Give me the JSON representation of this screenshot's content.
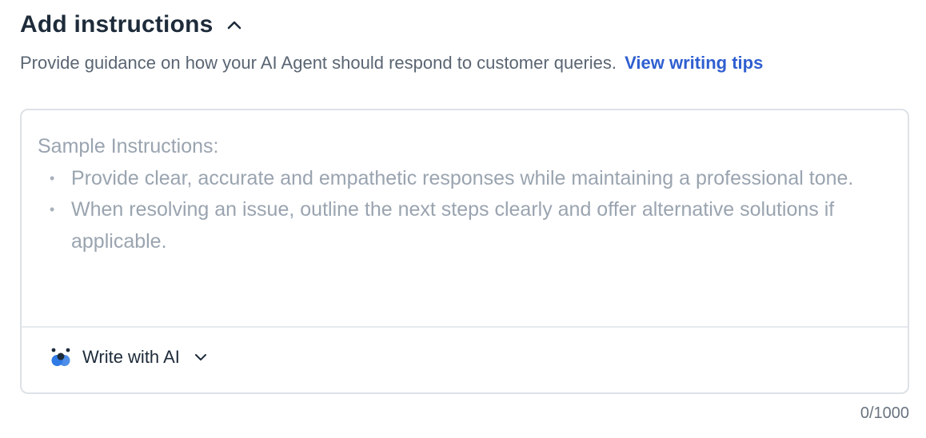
{
  "section": {
    "title": "Add instructions",
    "description": "Provide guidance on how your AI Agent should respond to customer queries.",
    "link_label": "View writing tips"
  },
  "editor": {
    "value": "",
    "placeholder_heading": "Sample Instructions:",
    "placeholder_items": [
      "Provide clear, accurate and empathetic responses while maintaining a professional tone.",
      "When resolving an issue, outline the next steps clearly and offer alternative solutions if applicable."
    ],
    "write_with_ai_label": "Write with AI",
    "char_count": "0/1000"
  },
  "icons": {
    "collapse": "chevron-up-icon",
    "ai": "ai-assistant-icon",
    "dropdown": "chevron-down-icon"
  },
  "colors": {
    "link": "#2f5fd0",
    "ai_icon_blue": "#2f7ae5",
    "ai_icon_dark": "#1d2b3a"
  }
}
